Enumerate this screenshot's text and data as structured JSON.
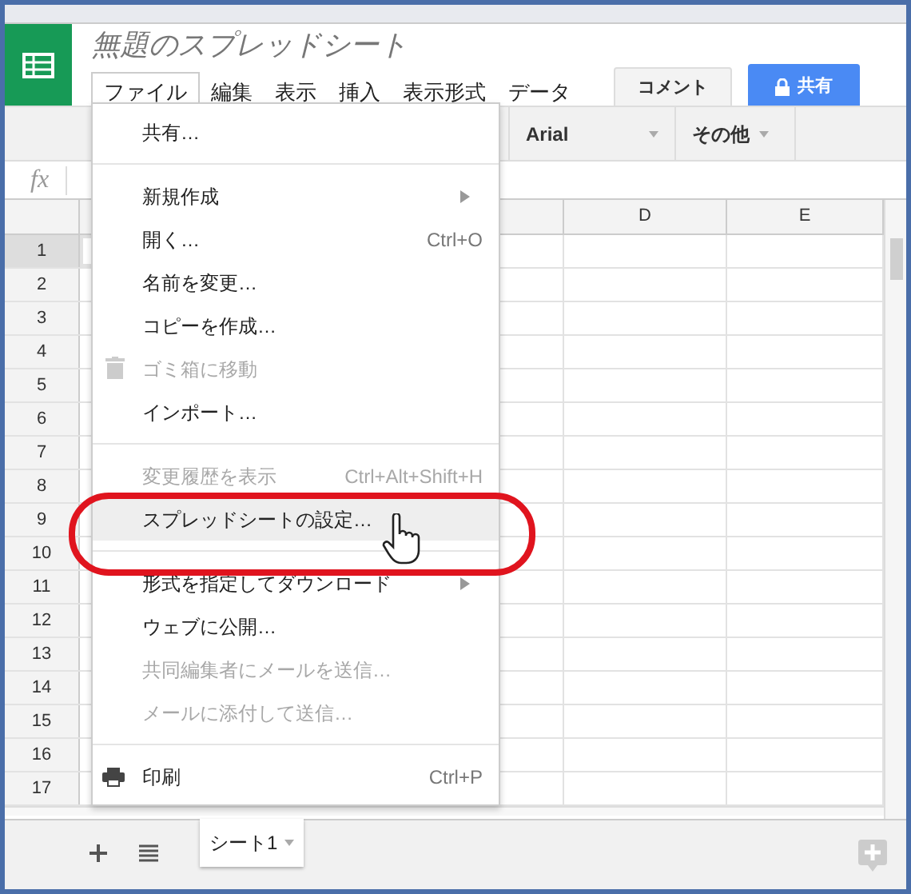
{
  "title": "無題のスプレッドシート",
  "menu_bar": [
    {
      "label": "ファイル",
      "selected": true
    },
    {
      "label": "編集",
      "selected": false
    },
    {
      "label": "表示",
      "selected": false
    },
    {
      "label": "挿入",
      "selected": false
    },
    {
      "label": "表示形式",
      "selected": false
    },
    {
      "label": "データ",
      "selected": false
    }
  ],
  "comment_button": "コメント",
  "share_button": "共有",
  "toolbar": {
    "font": "Arial",
    "more": "その他"
  },
  "formula_bar": {
    "label": "fx"
  },
  "columns": [
    "D",
    "E"
  ],
  "rows": [
    {
      "label": "1",
      "selected": true
    },
    {
      "label": "2",
      "selected": false
    },
    {
      "label": "3",
      "selected": false
    },
    {
      "label": "4",
      "selected": false
    },
    {
      "label": "5",
      "selected": false
    },
    {
      "label": "6",
      "selected": false
    },
    {
      "label": "7",
      "selected": false
    },
    {
      "label": "8",
      "selected": false
    },
    {
      "label": "9",
      "selected": false
    },
    {
      "label": "10",
      "selected": false
    },
    {
      "label": "11",
      "selected": false
    },
    {
      "label": "12",
      "selected": false
    },
    {
      "label": "13",
      "selected": false
    },
    {
      "label": "14",
      "selected": false
    },
    {
      "label": "15",
      "selected": false
    },
    {
      "label": "16",
      "selected": false
    },
    {
      "label": "17",
      "selected": false
    }
  ],
  "file_menu": [
    {
      "kind": "item",
      "label": "共有…",
      "disabled": false,
      "selected": false
    },
    {
      "kind": "divider"
    },
    {
      "kind": "item",
      "label": "新規作成",
      "submenu": true,
      "disabled": false,
      "selected": false
    },
    {
      "kind": "item",
      "label": "開く…",
      "shortcut": "Ctrl+O",
      "disabled": false,
      "selected": false
    },
    {
      "kind": "item",
      "label": "名前を変更…",
      "disabled": false,
      "selected": false
    },
    {
      "kind": "item",
      "label": "コピーを作成…",
      "disabled": false,
      "selected": false
    },
    {
      "kind": "trash",
      "label": "ゴミ箱に移動",
      "disabled": true,
      "selected": false
    },
    {
      "kind": "item",
      "label": "インポート…",
      "disabled": false,
      "selected": false
    },
    {
      "kind": "divider"
    },
    {
      "kind": "item",
      "label": "変更履歴を表示",
      "shortcut": "Ctrl+Alt+Shift+H",
      "disabled": true,
      "selected": false
    },
    {
      "kind": "item",
      "label": "スプレッドシートの設定…",
      "disabled": false,
      "selected": true
    },
    {
      "kind": "divider"
    },
    {
      "kind": "item",
      "label": "形式を指定してダウンロード",
      "submenu": true,
      "disabled": false,
      "selected": false
    },
    {
      "kind": "item",
      "label": "ウェブに公開…",
      "disabled": false,
      "selected": false
    },
    {
      "kind": "item",
      "label": "共同編集者にメールを送信…",
      "disabled": true,
      "selected": false
    },
    {
      "kind": "item",
      "label": "メールに添付して送信…",
      "disabled": true,
      "selected": false
    },
    {
      "kind": "divider"
    },
    {
      "kind": "print",
      "label": "印刷",
      "shortcut": "Ctrl+P",
      "disabled": false,
      "selected": false
    }
  ],
  "sheet_tabs": [
    {
      "label": "シート1",
      "selected": true
    }
  ]
}
